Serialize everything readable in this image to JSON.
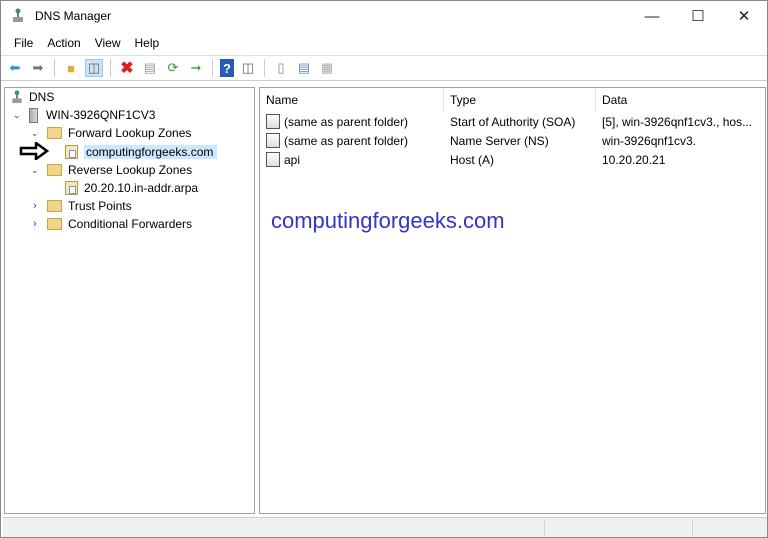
{
  "window": {
    "title": "DNS Manager"
  },
  "menu": [
    "File",
    "Action",
    "View",
    "Help"
  ],
  "tree": {
    "root": "DNS",
    "server": "WIN-3926QNF1CV3",
    "forward": "Forward Lookup Zones",
    "forward_zone": "computingforgeeks.com",
    "reverse": "Reverse Lookup Zones",
    "reverse_zone": "20.20.10.in-addr.arpa",
    "trust": "Trust Points",
    "conditional": "Conditional Forwarders"
  },
  "list": {
    "columns": [
      "Name",
      "Type",
      "Data"
    ],
    "rows": [
      {
        "name": "(same as parent folder)",
        "type": "Start of Authority (SOA)",
        "data": "[5], win-3926qnf1cv3., hos..."
      },
      {
        "name": "(same as parent folder)",
        "type": "Name Server (NS)",
        "data": "win-3926qnf1cv3."
      },
      {
        "name": "api",
        "type": "Host (A)",
        "data": "10.20.20.21"
      }
    ]
  },
  "watermark": "computingforgeeks.com"
}
